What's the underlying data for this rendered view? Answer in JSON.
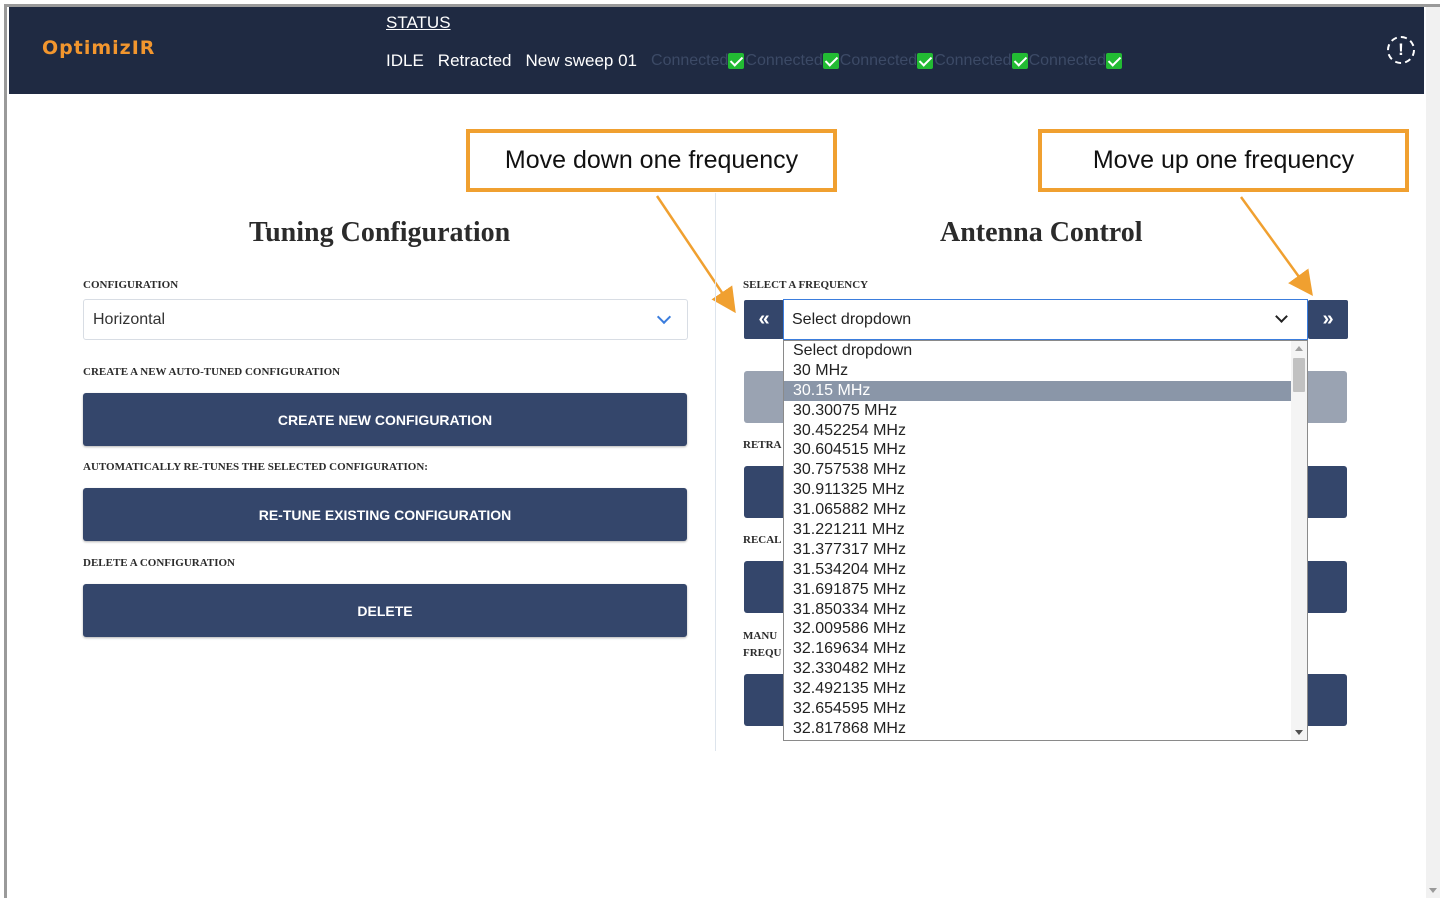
{
  "header": {
    "logo": "OptimizIR",
    "status_link": "STATUS",
    "status_items": [
      "IDLE",
      "Retracted",
      "New sweep 01"
    ],
    "connections": [
      "Connected",
      "Connected",
      "Connected",
      "Connected",
      "Connected"
    ],
    "alert_icon": "alert-circle-icon"
  },
  "callouts": {
    "down": "Move down one frequency",
    "up": "Move up one frequency",
    "color": "#f0a030"
  },
  "tuning": {
    "title": "Tuning Configuration",
    "config_label": "CONFIGURATION",
    "config_value": "Horizontal",
    "create_label": "CREATE A NEW AUTO-TUNED CONFIGURATION",
    "create_button": "CREATE NEW CONFIGURATION",
    "retune_label": "AUTOMATICALLY RE-TUNES THE SELECTED CONFIGURATION:",
    "retune_button": "RE-TUNE EXISTING CONFIGURATION",
    "delete_label": "DELETE A CONFIGURATION",
    "delete_button": "DELETE"
  },
  "antenna": {
    "title": "Antenna Control",
    "freq_label": "SELECT A FREQUENCY",
    "prev_button": "«",
    "next_button": "»",
    "select_value": "Select dropdown",
    "partial_labels": [
      "RETRA",
      "RECAL",
      "MANU",
      "FREQU"
    ],
    "options": [
      "Select dropdown",
      "30 MHz",
      "30.15 MHz",
      "30.30075 MHz",
      "30.452254 MHz",
      "30.604515 MHz",
      "30.757538 MHz",
      "30.911325 MHz",
      "31.065882 MHz",
      "31.221211 MHz",
      "31.377317 MHz",
      "31.534204 MHz",
      "31.691875 MHz",
      "31.850334 MHz",
      "32.009586 MHz",
      "32.169634 MHz",
      "32.330482 MHz",
      "32.492135 MHz",
      "32.654595 MHz",
      "32.817868 MHz"
    ],
    "highlighted_option": "30.15 MHz"
  },
  "colors": {
    "header_bg": "#1f2a42",
    "logo": "#f2962e",
    "button_bg": "#34466b",
    "connected_check": "#22bb33"
  }
}
